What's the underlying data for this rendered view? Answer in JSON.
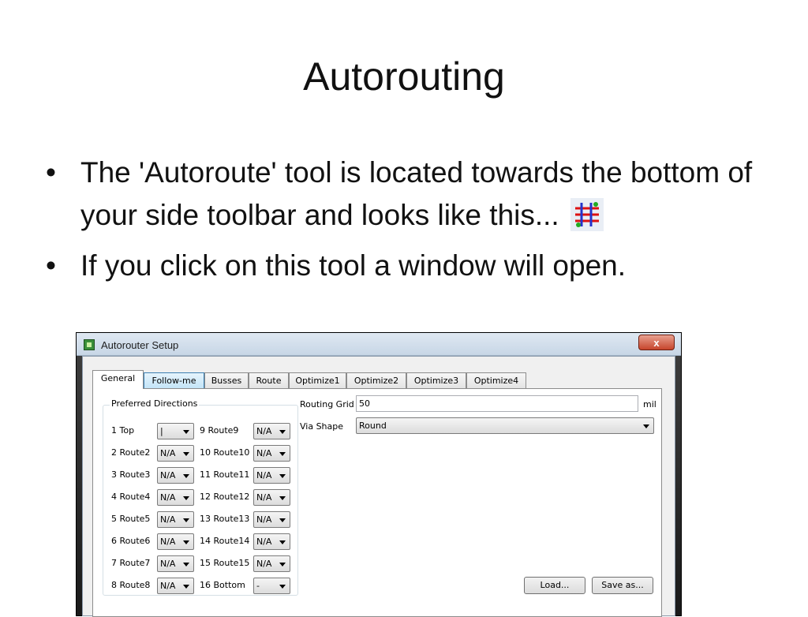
{
  "slide": {
    "title": "Autorouting",
    "bullets": [
      "The 'Autoroute' tool is located towards the bottom of your side toolbar and looks like this...",
      "If you click on this tool a window will open."
    ]
  },
  "window": {
    "title": "Autorouter Setup",
    "close_label": "x"
  },
  "tabs": [
    "General",
    "Follow-me",
    "Busses",
    "Route",
    "Optimize1",
    "Optimize2",
    "Optimize3",
    "Optimize4"
  ],
  "preferred_directions": {
    "title": "Preferred Directions",
    "left": [
      {
        "label": "1 Top",
        "value": "|"
      },
      {
        "label": "2 Route2",
        "value": "N/A"
      },
      {
        "label": "3 Route3",
        "value": "N/A"
      },
      {
        "label": "4 Route4",
        "value": "N/A"
      },
      {
        "label": "5 Route5",
        "value": "N/A"
      },
      {
        "label": "6 Route6",
        "value": "N/A"
      },
      {
        "label": "7 Route7",
        "value": "N/A"
      },
      {
        "label": "8 Route8",
        "value": "N/A"
      }
    ],
    "right": [
      {
        "label": "9 Route9",
        "value": "N/A"
      },
      {
        "label": "10 Route10",
        "value": "N/A"
      },
      {
        "label": "11 Route11",
        "value": "N/A"
      },
      {
        "label": "12 Route12",
        "value": "N/A"
      },
      {
        "label": "13 Route13",
        "value": "N/A"
      },
      {
        "label": "14 Route14",
        "value": "N/A"
      },
      {
        "label": "15 Route15",
        "value": "N/A"
      },
      {
        "label": "16 Bottom",
        "value": "-"
      }
    ]
  },
  "routing_grid": {
    "label": "Routing Grid",
    "value": "50",
    "unit": "mil"
  },
  "via_shape": {
    "label": "Via Shape",
    "value": "Round"
  },
  "buttons": {
    "load": "Load...",
    "save_as": "Save as..."
  },
  "colors": {
    "accent_tab": "#c3e4f7",
    "close_button": "#c6452c"
  }
}
